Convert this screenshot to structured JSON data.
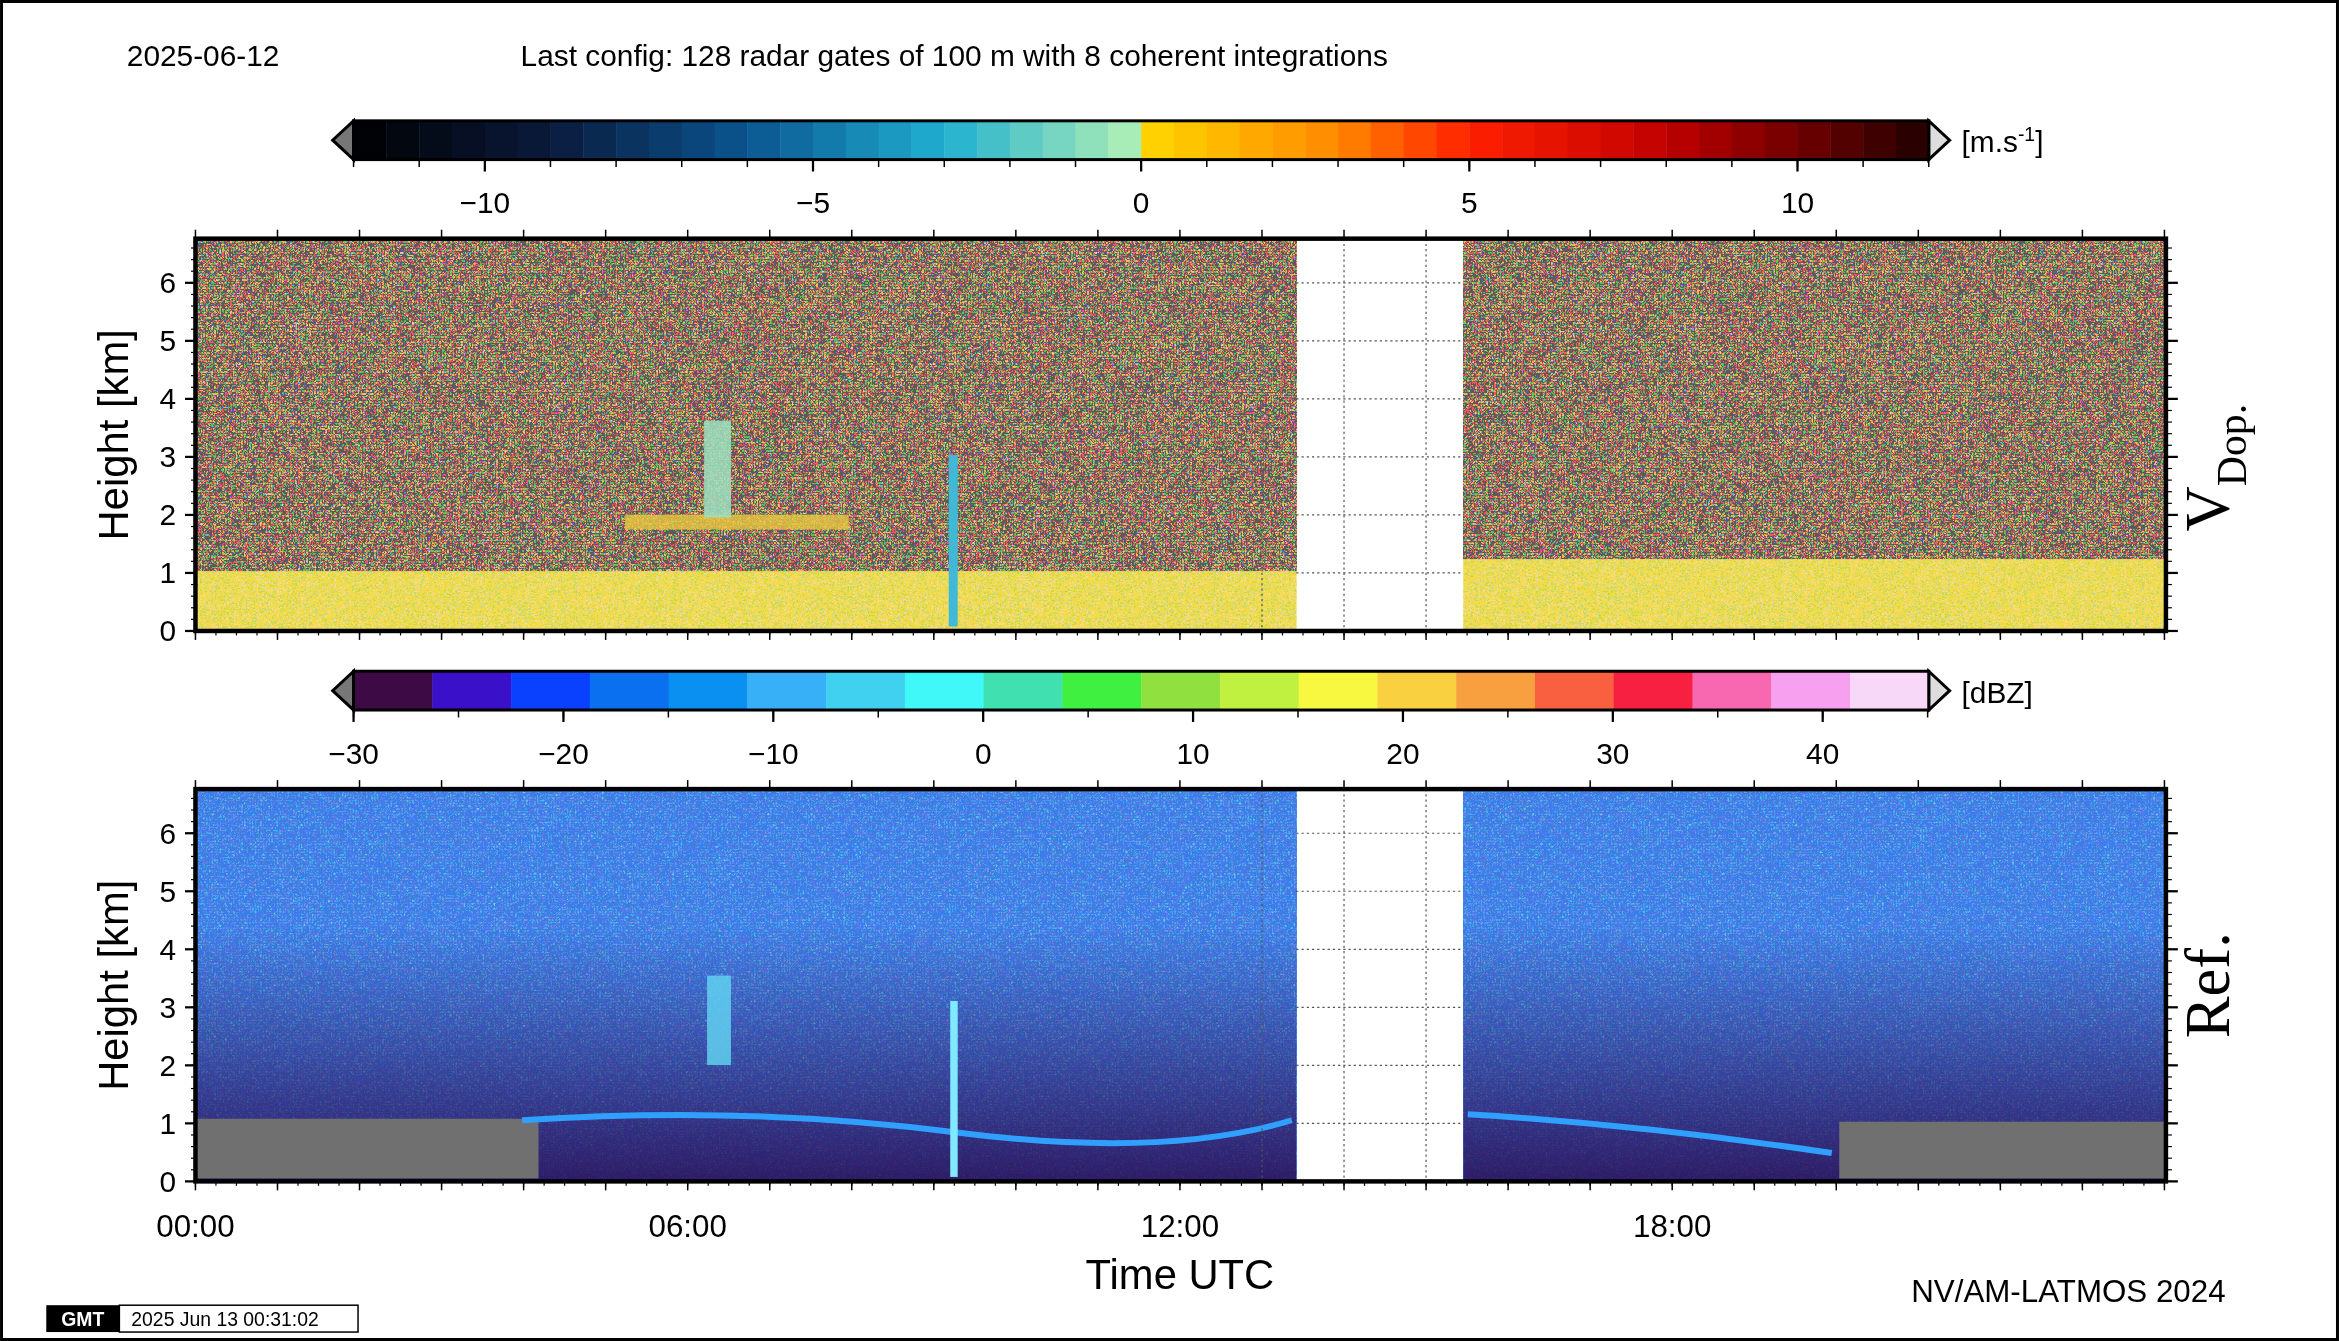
{
  "header": {
    "date": "2025-06-12",
    "config": "Last config: 128 radar gates of 100 m with 8 coherent integrations"
  },
  "colorbars": [
    {
      "kind": "velocity",
      "unit": "[m.s",
      "unit_sup": "-1",
      "unit_end": "]",
      "ticks": [
        "−10",
        "−5",
        "0",
        "5",
        "10"
      ]
    },
    {
      "kind": "reflectivity",
      "unit": "[dBZ]",
      "ticks": [
        "−30",
        "−20",
        "−10",
        "0",
        "10",
        "20",
        "30",
        "40"
      ]
    }
  ],
  "panels": [
    {
      "kind": "velocity",
      "ylabel": "Height [km]",
      "yticks": [
        "6",
        "5",
        "4",
        "3",
        "2",
        "1",
        "0"
      ],
      "title": "V",
      "title_sub": "Dop."
    },
    {
      "kind": "reflectivity",
      "ylabel": "Height [km]",
      "yticks": [
        "6",
        "5",
        "4",
        "3",
        "2",
        "1",
        "0"
      ],
      "title": "Ref."
    }
  ],
  "xaxis": {
    "ticks": [
      "00:00",
      "06:00",
      "12:00",
      "18:00"
    ],
    "label": "Time UTC"
  },
  "footer": {
    "credit": "NV/AM-LATMOS 2024",
    "logo": "GMT",
    "timestamp": "2025 Jun 13 00:31:02"
  }
}
